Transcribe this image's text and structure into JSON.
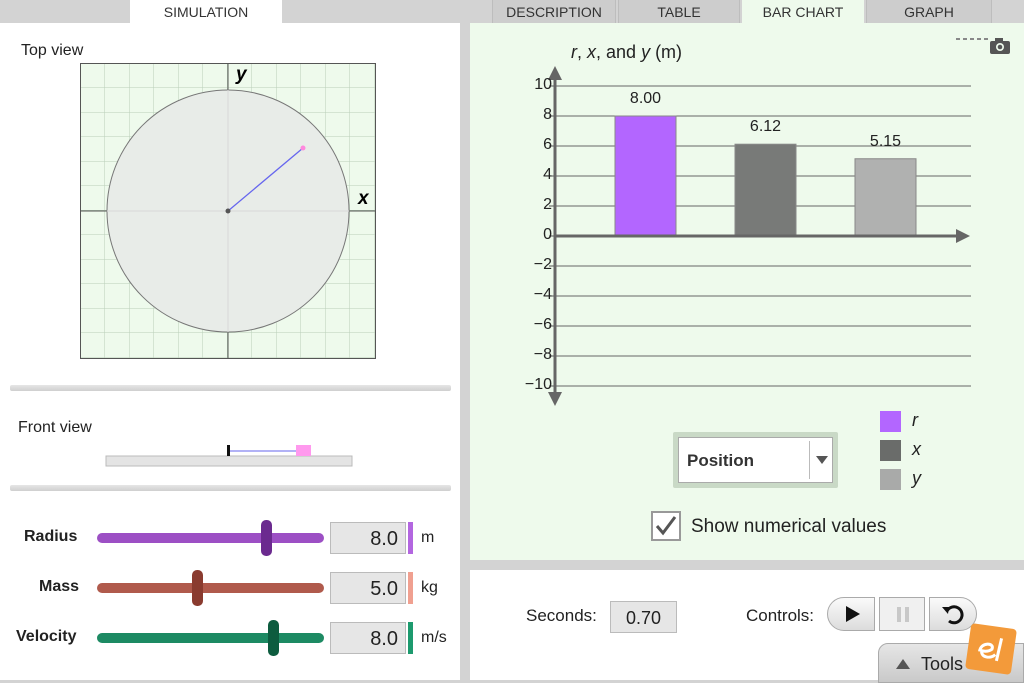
{
  "tabs": {
    "simulation": "SIMULATION",
    "description": "DESCRIPTION",
    "table": "TABLE",
    "bar_chart": "BAR CHART",
    "graph": "GRAPH"
  },
  "top_view": {
    "title": "Top view",
    "x_axis": "x",
    "y_axis": "y"
  },
  "front_view": {
    "title": "Front view"
  },
  "sliders": {
    "radius": {
      "label": "Radius",
      "value": "8.0",
      "unit": "m",
      "color": "#9c4fc4",
      "level": 0.68
    },
    "mass": {
      "label": "Mass",
      "value": "5.0",
      "unit": "kg",
      "color": "#b05a4c",
      "level": 0.45
    },
    "velocity": {
      "label": "Velocity",
      "value": "8.0",
      "unit": "m/s",
      "color": "#1d8a63",
      "level": 0.78
    }
  },
  "chart_data": {
    "type": "bar",
    "ylabel_parts": [
      "r",
      ", ",
      "x",
      ", and ",
      "y",
      " (m)"
    ],
    "ylim": [
      -10,
      10
    ],
    "yticks": [
      "10",
      "8",
      "6",
      "4",
      "2",
      "0",
      "−2",
      "−4",
      "−6",
      "−8",
      "−10"
    ],
    "series": [
      {
        "name": "r",
        "value": 8.0,
        "label": "8.00",
        "color": "#b366ff"
      },
      {
        "name": "x",
        "value": 6.12,
        "label": "6.12",
        "color": "#787a78"
      },
      {
        "name": "y",
        "value": 5.15,
        "label": "5.15",
        "color": "#b0b1b0"
      }
    ],
    "grid": true
  },
  "chart_controls": {
    "dropdown_value": "Position",
    "checkbox_label": "Show numerical values",
    "checkbox_checked": true
  },
  "bottom": {
    "seconds_label": "Seconds:",
    "seconds_value": "0.70",
    "controls_label": "Controls:",
    "tools_label": "Tools"
  }
}
